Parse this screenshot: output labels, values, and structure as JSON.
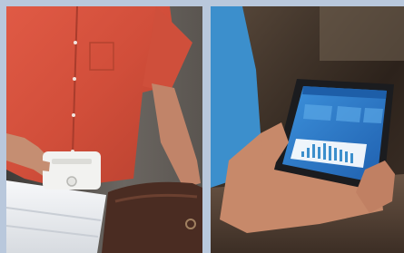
{
  "scene": {
    "left_photo": {
      "subject": "person-in-red-shirt-placing-device-into-container",
      "colors": {
        "shirt": "#d5533f",
        "background": "#56524d",
        "container": "#eef0f2",
        "device": "#f2f2f0",
        "bag": "#4a2c22"
      }
    },
    "right_photo": {
      "subject": "person-holding-tablet-with-blue-dashboard",
      "colors": {
        "sleeve": "#3c8fcc",
        "skin": "#c7896a",
        "tablet_screen": "#2f7fd0",
        "background": "#3a2e25",
        "table": "#5b4638"
      }
    },
    "frame_color": "#b9c8dc"
  }
}
